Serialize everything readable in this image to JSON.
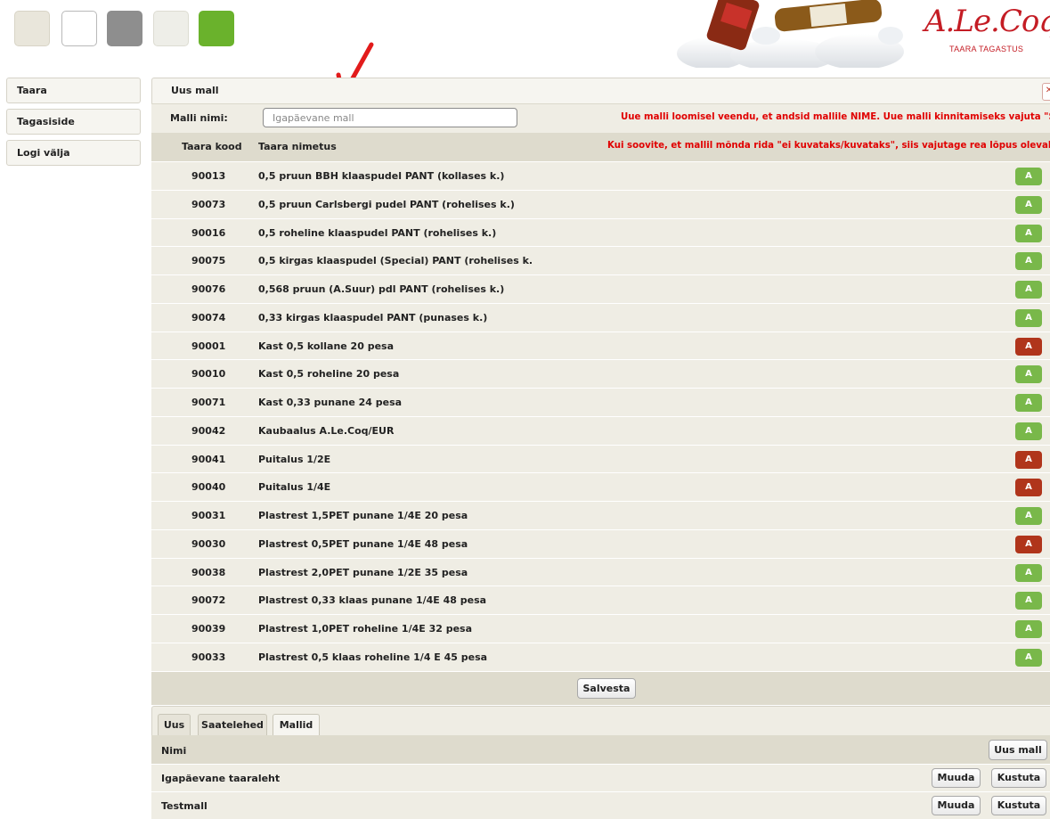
{
  "colors": {
    "swatches": [
      "#e9e6db",
      "#ffffff",
      "#8e8e8e",
      "#eeeee8",
      "#6ab22c"
    ],
    "green_button": "#79b84a",
    "red_button": "#b0351b",
    "warning_text": "#e00000",
    "brand_red": "#c41c24"
  },
  "header": {
    "logo_script": "A.Le.Coq",
    "logo_subtitle": "TAARA TAGASTUS"
  },
  "sidebar": {
    "items": [
      {
        "label": "Taara"
      },
      {
        "label": "Tagasiside"
      },
      {
        "label": "Logi välja"
      }
    ]
  },
  "form": {
    "title": "Uus mall",
    "close_icon": "close-icon",
    "name_label": "Malli nimi:",
    "name_value": "Igapäevane mall",
    "name_warning": "Uue malli loomisel veendu, et andsid mallile NIME. Uue malli kinnitamiseks vajuta \"Salvesta\"",
    "columns": {
      "code": "Taara kood",
      "name": "Taara nimetus",
      "hint": "Kui soovite, et mallil mõnda rida \"ei kuvataks/kuvataks\", siis vajutage rea lõpus olevale ikoonile"
    },
    "rows": [
      {
        "code": "90013",
        "name": "0,5 pruun BBH klaaspudel PANT (kollases k.)",
        "toggle": "A",
        "state": "green"
      },
      {
        "code": "90073",
        "name": "0,5 pruun Carlsbergi pudel PANT (rohelises k.)",
        "toggle": "A",
        "state": "green"
      },
      {
        "code": "90016",
        "name": "0,5 roheline klaaspudel PANT (rohelises k.)",
        "toggle": "A",
        "state": "green"
      },
      {
        "code": "90075",
        "name": "0,5 kirgas klaaspudel (Special) PANT (rohelises k.",
        "toggle": "A",
        "state": "green"
      },
      {
        "code": "90076",
        "name": "0,568 pruun (A.Suur) pdl PANT (rohelises k.)",
        "toggle": "A",
        "state": "green"
      },
      {
        "code": "90074",
        "name": "0,33 kirgas klaaspudel PANT (punases k.)",
        "toggle": "A",
        "state": "green"
      },
      {
        "code": "90001",
        "name": "Kast 0,5 kollane 20 pesa",
        "toggle": "A",
        "state": "red"
      },
      {
        "code": "90010",
        "name": "Kast 0,5 roheline 20 pesa",
        "toggle": "A",
        "state": "green"
      },
      {
        "code": "90071",
        "name": "Kast 0,33 punane 24 pesa",
        "toggle": "A",
        "state": "green"
      },
      {
        "code": "90042",
        "name": "Kaubaalus A.Le.Coq/EUR",
        "toggle": "A",
        "state": "green"
      },
      {
        "code": "90041",
        "name": "Puitalus 1/2E",
        "toggle": "A",
        "state": "red"
      },
      {
        "code": "90040",
        "name": "Puitalus 1/4E",
        "toggle": "A",
        "state": "red"
      },
      {
        "code": "90031",
        "name": "Plastrest 1,5PET punane 1/4E 20 pesa",
        "toggle": "A",
        "state": "green"
      },
      {
        "code": "90030",
        "name": "Plastrest 0,5PET punane 1/4E 48 pesa",
        "toggle": "A",
        "state": "red"
      },
      {
        "code": "90038",
        "name": "Plastrest 2,0PET punane 1/2E 35 pesa",
        "toggle": "A",
        "state": "green"
      },
      {
        "code": "90072",
        "name": "Plastrest 0,33 klaas punane 1/4E 48 pesa",
        "toggle": "A",
        "state": "green"
      },
      {
        "code": "90039",
        "name": "Plastrest 1,0PET roheline 1/4E 32 pesa",
        "toggle": "A",
        "state": "green"
      },
      {
        "code": "90033",
        "name": "Plastrest 0,5 klaas roheline 1/4 E 45 pesa",
        "toggle": "A",
        "state": "green"
      }
    ],
    "save_label": "Salvesta"
  },
  "templates": {
    "tabs": [
      {
        "label": "Uus",
        "active": false
      },
      {
        "label": "Saatelehed",
        "active": false
      },
      {
        "label": "Mallid",
        "active": true
      }
    ],
    "column_name": "Nimi",
    "new_label": "Uus mall",
    "rows": [
      {
        "name": "Igapäevane taaraleht",
        "edit": "Muuda",
        "delete": "Kustuta"
      },
      {
        "name": "Testmall",
        "edit": "Muuda",
        "delete": "Kustuta"
      }
    ]
  }
}
